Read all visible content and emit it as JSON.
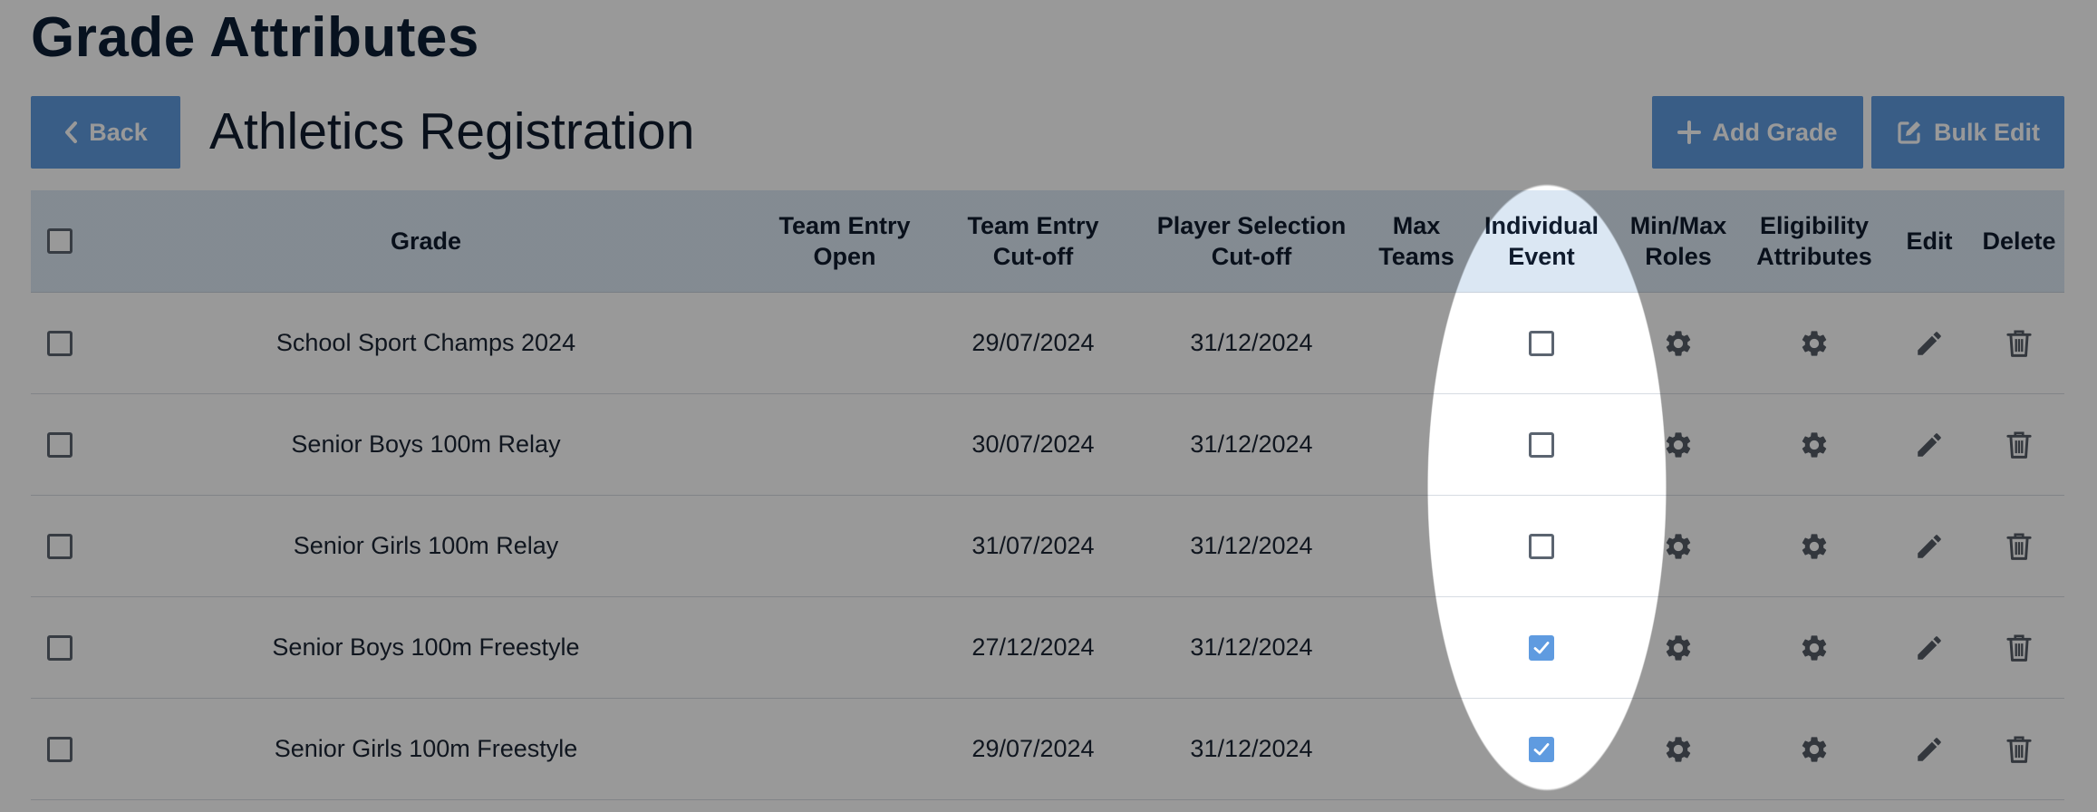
{
  "page": {
    "title": "Grade Attributes",
    "subtitle": "Athletics Registration"
  },
  "toolbar": {
    "back_label": "Back",
    "add_grade_label": "Add Grade",
    "bulk_edit_label": "Bulk Edit"
  },
  "table": {
    "headers": {
      "grade": "Grade",
      "team_entry_open": "Team Entry\nOpen",
      "team_entry_cutoff": "Team Entry\nCut-off",
      "player_selection_cutoff": "Player Selection\nCut-off",
      "max_teams": "Max\nTeams",
      "individual_event": "Individual\nEvent",
      "min_max_roles": "Min/Max\nRoles",
      "eligibility_attributes": "Eligibility\nAttributes",
      "edit": "Edit",
      "delete": "Delete"
    },
    "rows": [
      {
        "grade": "School Sport Champs 2024",
        "team_entry_open": "",
        "team_entry_cutoff": "29/07/2024",
        "player_selection_cutoff": "31/12/2024",
        "max_teams": "",
        "individual_event": false
      },
      {
        "grade": "Senior Boys 100m Relay",
        "team_entry_open": "",
        "team_entry_cutoff": "30/07/2024",
        "player_selection_cutoff": "31/12/2024",
        "max_teams": "",
        "individual_event": false
      },
      {
        "grade": "Senior Girls 100m Relay",
        "team_entry_open": "",
        "team_entry_cutoff": "31/07/2024",
        "player_selection_cutoff": "31/12/2024",
        "max_teams": "",
        "individual_event": false
      },
      {
        "grade": "Senior Boys 100m Freestyle",
        "team_entry_open": "",
        "team_entry_cutoff": "27/12/2024",
        "player_selection_cutoff": "31/12/2024",
        "max_teams": "",
        "individual_event": true
      },
      {
        "grade": "Senior Girls 100m Freestyle",
        "team_entry_open": "",
        "team_entry_cutoff": "29/07/2024",
        "player_selection_cutoff": "31/12/2024",
        "max_teams": "",
        "individual_event": true
      }
    ]
  },
  "icons": {
    "back": "chevron-left-icon",
    "add": "plus-icon",
    "bulk_edit": "edit-square-icon",
    "min_max_roles": "gear-icon",
    "eligibility": "gear-icon",
    "edit": "pencil-icon",
    "delete": "trash-icon",
    "checked": "checkmark-icon"
  },
  "colors": {
    "accent": "#5f9be0",
    "header_bg": "#dbe7f3",
    "title": "#0b1d33",
    "icon": "#555c66"
  }
}
